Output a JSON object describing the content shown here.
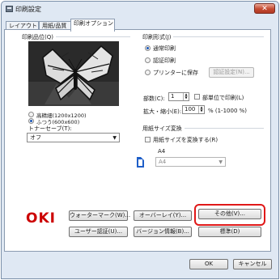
{
  "window": {
    "title": "印刷設定",
    "close_label": "✕"
  },
  "tabs": [
    {
      "label": "レイアウト"
    },
    {
      "label": "用紙/品質"
    },
    {
      "label": "印刷オプション"
    }
  ],
  "quality": {
    "heading": "印刷品位(Q)",
    "options": [
      {
        "label": "高精細(1200x1200)",
        "selected": false
      },
      {
        "label": "ふつう(600x600)",
        "selected": true
      }
    ],
    "toner_label": "トナーセーブ(T):",
    "toner_value": "オフ"
  },
  "print_format": {
    "heading": "印刷形式(J)",
    "options": [
      {
        "label": "通常印刷",
        "selected": true
      },
      {
        "label": "認証印刷",
        "selected": false
      },
      {
        "label": "プリンターに保存",
        "selected": false
      }
    ],
    "auth_button": "認証設定(N)...",
    "copies_label": "部数(C):",
    "copies_value": "1",
    "collate_label": "部単位で印刷(L)",
    "scale_label": "拡大・縮小(E):",
    "scale_value": "100",
    "scale_range": "% (1-1000 %)"
  },
  "paper_convert": {
    "heading": "用紙サイズ変換",
    "checkbox_label": "用紙サイズを変換する(R)",
    "size_label": "A4",
    "size_select": "A4"
  },
  "bottom": {
    "logo": "OKI",
    "watermark_button": "ウォーターマーク(W)...",
    "overlay_button": "オーバーレイ(Y)...",
    "other_button": "その他(V)...",
    "user_auth_button": "ユーザー認証(U)...",
    "version_button": "バージョン情報(B)...",
    "defaults_button": "標準(D)"
  },
  "dialog": {
    "ok": "OK",
    "cancel": "キャンセル"
  },
  "colors": {
    "accent_red": "#e01818",
    "logo_red": "#cc0000",
    "window_bg": "#dfe8f3"
  }
}
